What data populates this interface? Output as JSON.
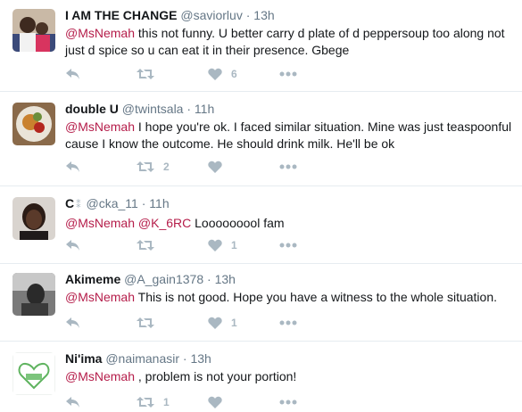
{
  "tweets": [
    {
      "name": "I AM THE CHANGE",
      "handle": "@saviorluv",
      "sep": "·",
      "time": "13h",
      "mention": "@MsNemah",
      "text": " this not funny. U better carry d plate of d peppersoup too along not just d spice so u can eat it in their presence. Gbege",
      "retweets": "",
      "likes": "6"
    },
    {
      "name": "double U",
      "handle": "@twintsala",
      "sep": "·",
      "time": "11h",
      "mention": "@MsNemah",
      "text": " I hope you're ok. I faced similar situation. Mine was just teaspoonful cause I know the outcome. He should drink milk. He'll be ok",
      "retweets": "2",
      "likes": ""
    },
    {
      "name": "C",
      "handle": "@cka_11",
      "sep": "·",
      "time": "11h",
      "mention": "@MsNemah",
      "mention2": "@K_6RC",
      "text": " Looooooool fam",
      "retweets": "",
      "likes": "1"
    },
    {
      "name": "Akimeme",
      "handle": "@A_gain1378",
      "sep": "·",
      "time": "13h",
      "mention": "@MsNemah",
      "text": " This is not good. Hope you have a witness to the whole situation.",
      "retweets": "",
      "likes": "1"
    },
    {
      "name": "Ni'ima",
      "handle": "@naimanasir",
      "sep": "·",
      "time": "13h",
      "mention": "@MsNemah",
      "text": " , problem is not your portion!",
      "retweets": "1",
      "likes": ""
    }
  ],
  "colors": {
    "mention": "#b51d4a",
    "meta": "#657786",
    "icon": "#aab8c2"
  },
  "icons": [
    "reply-icon",
    "retweet-icon",
    "like-icon",
    "more-icon"
  ]
}
